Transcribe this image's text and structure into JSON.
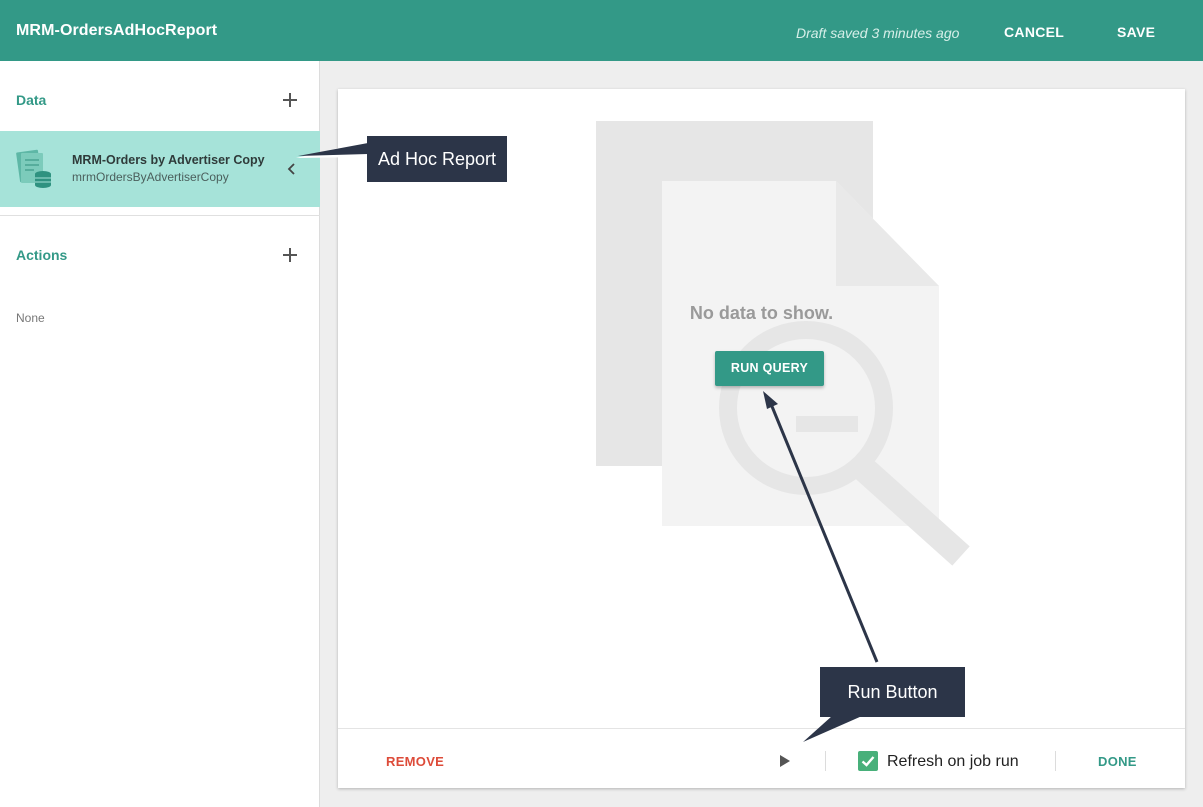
{
  "header": {
    "title": "MRM-OrdersAdHocReport",
    "draft_status": "Draft saved 3 minutes ago",
    "cancel_label": "CANCEL",
    "save_label": "SAVE",
    "accent_color": "#339987"
  },
  "sidebar": {
    "data_section": {
      "title": "Data",
      "add_icon": "plus-icon",
      "items": [
        {
          "name": "MRM-Orders by Advertiser Copy",
          "id": "mrmOrdersByAdvertiserCopy",
          "icon": "report-database-icon",
          "action_icon": "chevron-left-icon"
        }
      ]
    },
    "actions_section": {
      "title": "Actions",
      "add_icon": "plus-icon",
      "empty_text": "None"
    }
  },
  "main": {
    "empty_state": {
      "message": "No data to show.",
      "run_query_label": "RUN QUERY",
      "illustration_icon": "document-search-icon"
    },
    "footer": {
      "remove_label": "REMOVE",
      "play_icon": "play-icon",
      "refresh_checked": true,
      "refresh_label": "Refresh on job run",
      "done_label": "DONE"
    }
  },
  "annotations": {
    "adhoc_callout": "Ad Hoc Report",
    "run_callout": "Run Button"
  }
}
